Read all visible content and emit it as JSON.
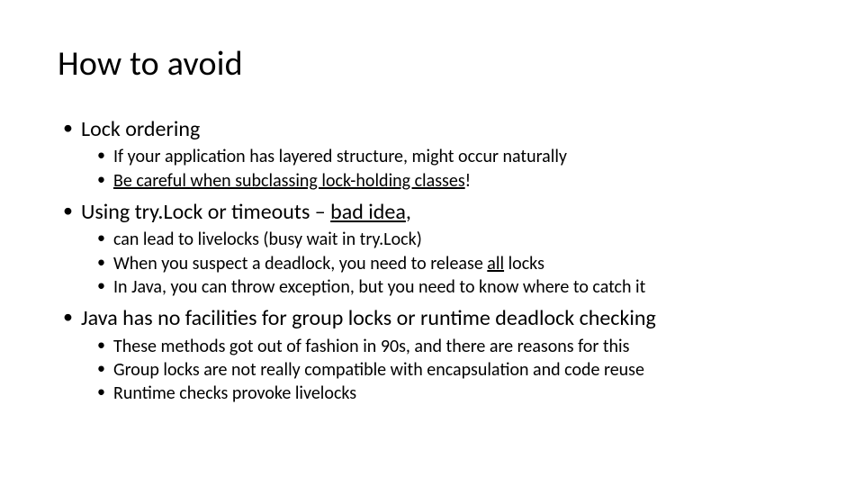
{
  "title": "How to avoid",
  "b1": {
    "label": "Lock ordering",
    "s1": "If your application has layered structure, might occur naturally",
    "s2_pre": "",
    "s2_u": "Be careful when subclassing lock-holding classes",
    "s2_post": "!"
  },
  "b2": {
    "pre": "Using try.Lock or timeouts – ",
    "u": "bad idea",
    "post": ",",
    "s1": "can lead to livelocks (busy wait in try.Lock)",
    "s2_pre": "When you suspect a deadlock, you need to release ",
    "s2_u": "all",
    "s2_post": " locks",
    "s3": "In Java, you can throw exception, but you need to know where to catch it"
  },
  "b3": {
    "label": "Java has no facilities for group locks or runtime deadlock checking",
    "s1": "These methods got out of fashion in 90s, and there are reasons for this",
    "s2": "Group locks are not really compatible with encapsulation and code reuse",
    "s3": "Runtime checks provoke livelocks"
  }
}
